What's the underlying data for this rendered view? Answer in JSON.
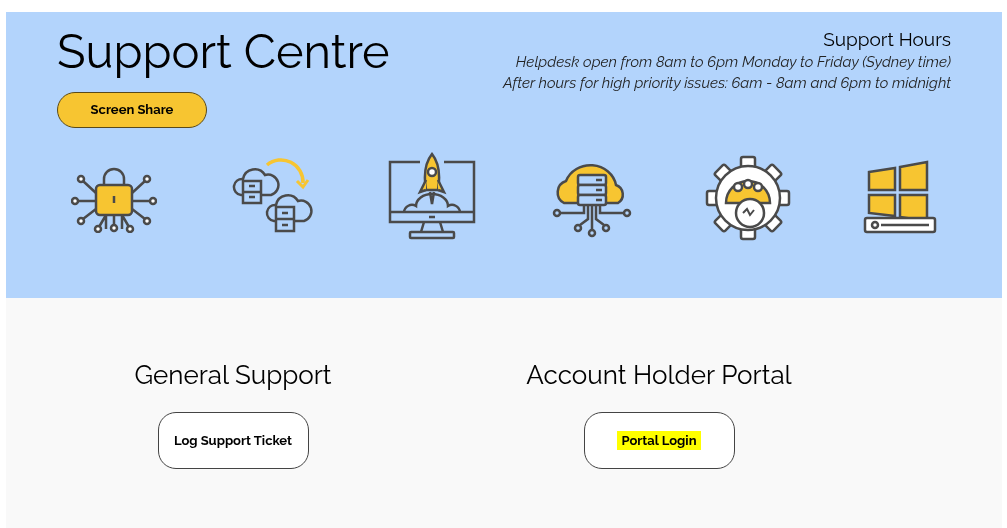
{
  "header": {
    "title": "Support Centre",
    "screen_share_button": "Screen Share"
  },
  "support_hours": {
    "heading": "Support Hours",
    "lines": [
      "Helpdesk open from 8am to 6pm Monday to Friday (Sydney time)",
      "After hours for high priority issues: 6am - 8am and 6pm to midnight"
    ]
  },
  "sections": [
    {
      "heading": "General Support",
      "button": "Log Support Ticket",
      "highlighted": false
    },
    {
      "heading": "Account Holder Portal",
      "button": "Portal Login",
      "highlighted": true
    }
  ]
}
